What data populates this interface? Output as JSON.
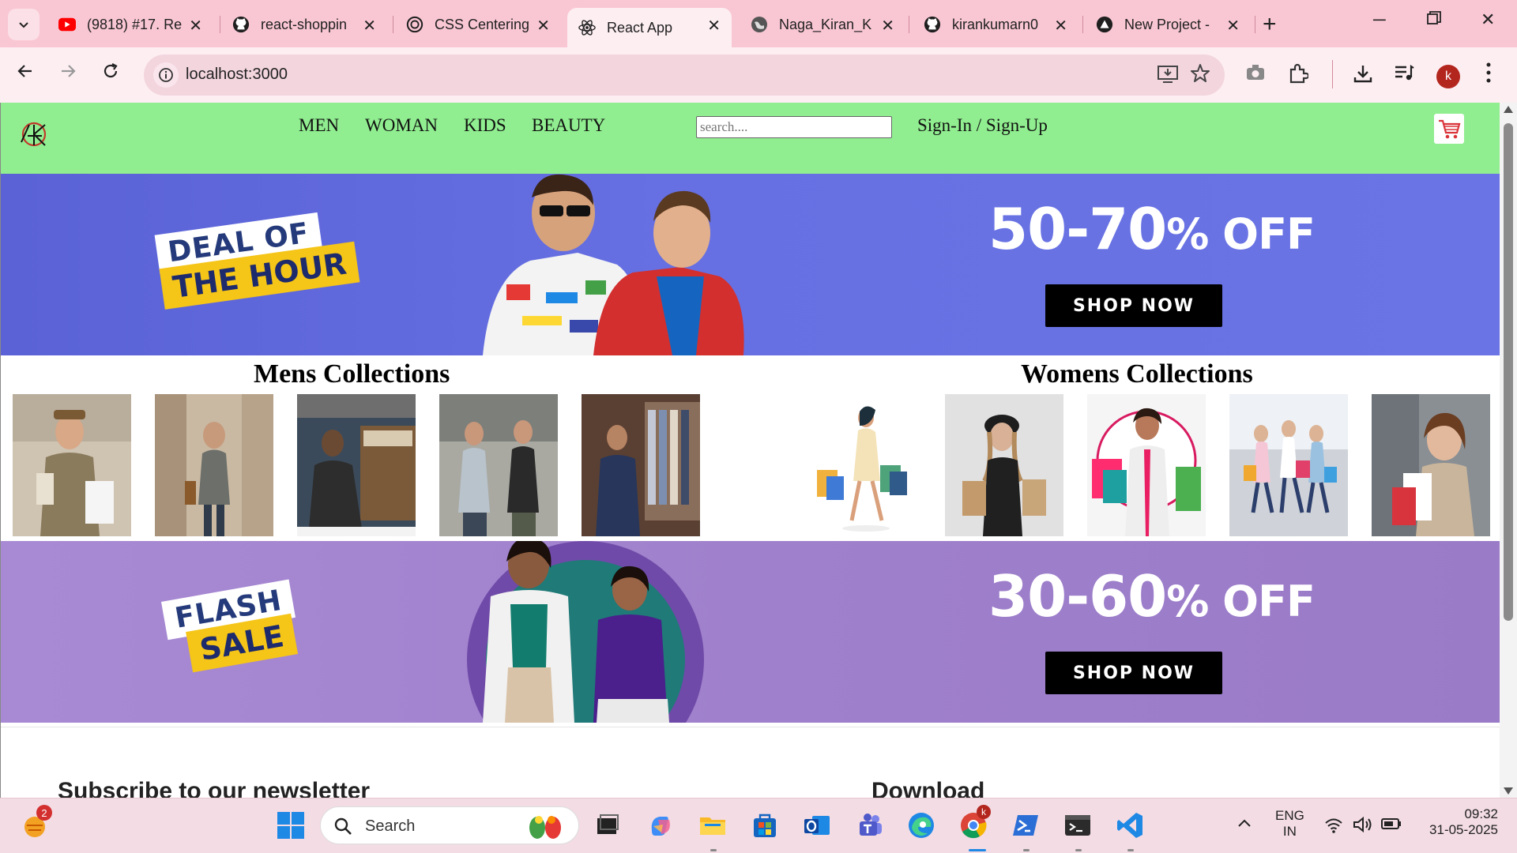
{
  "browser": {
    "tabs": [
      {
        "title": "(9818) #17. Re",
        "icon": "youtube-icon",
        "active": false
      },
      {
        "title": "react-shoppin",
        "icon": "github-icon",
        "active": false
      },
      {
        "title": "CSS Centering",
        "icon": "openai-icon",
        "active": false
      },
      {
        "title": "React App",
        "icon": "react-icon",
        "active": true
      },
      {
        "title": "Naga_Kiran_K",
        "icon": "globe-icon",
        "active": false
      },
      {
        "title": "kirankumarn0",
        "icon": "github-icon",
        "active": false
      },
      {
        "title": "New Project -",
        "icon": "vercel-icon",
        "active": false
      }
    ],
    "new_tab_label": "+",
    "url": "localhost:3000",
    "profile_initial": "k"
  },
  "site": {
    "nav": [
      "MEN",
      "WOMAN",
      "KIDS",
      "BEAUTY"
    ],
    "search_placeholder": "search....",
    "signin_label": "Sign-In / Sign-Up",
    "banner1": {
      "sticker_line1": "DEAL OF",
      "sticker_line2": "THE HOUR",
      "offer_range": "50-70",
      "offer_pct": "% OFF",
      "button": "SHOP NOW"
    },
    "banner2": {
      "sticker_line1": "FLASH",
      "sticker_line2": "SALE",
      "offer_range": "30-60",
      "offer_pct": "% OFF",
      "button": "SHOP NOW"
    },
    "mens_title": "Mens Collections",
    "womens_title": "Womens Collections",
    "mens_images": [
      "men-1",
      "men-2",
      "men-3",
      "men-4",
      "men-5"
    ],
    "womens_images": [
      "women-1",
      "women-2",
      "women-3",
      "women-4",
      "women-5"
    ],
    "below_headings": [
      "Subscribe to our newsletter",
      "Download"
    ]
  },
  "taskbar": {
    "search_label": "Search",
    "notification_count": "2",
    "lang_line1": "ENG",
    "lang_line2": "IN",
    "time": "09:32",
    "date": "31-05-2025"
  },
  "colors": {
    "tab_strip": "#f9c7d4",
    "toolbar": "#fdeef2",
    "navbar": "#90ee90",
    "banner1": "#6670e2",
    "banner2": "#9f80cc",
    "button": "#000000"
  }
}
